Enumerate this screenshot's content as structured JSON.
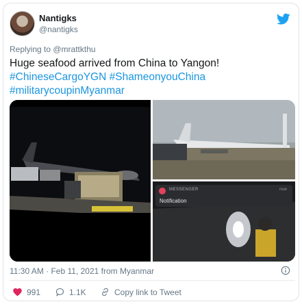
{
  "user": {
    "display_name": "Nantigks",
    "handle": "@nantigks"
  },
  "reply": {
    "prefix": "Replying to ",
    "to": "@mrattkthu"
  },
  "tweet": {
    "line1": "Huge seafood arrived from China to Yangon!",
    "hashtag1": "#ChineseCargoYGN",
    "hashtag2": "#ShameonyouChina",
    "hashtag3": "#militarycoupinMyanmar"
  },
  "media": {
    "notification": {
      "app": "MESSENGER",
      "time": "now",
      "title": "Notification"
    }
  },
  "meta": {
    "timestamp": "11:30 AM · Feb 11, 2021 from Myanmar"
  },
  "actions": {
    "likes": "991",
    "replies": "1.1K",
    "copy_link": "Copy link to Tweet"
  },
  "colors": {
    "brand": "#1da1f2",
    "like": "#e0245e",
    "hashtag": "#1b95e0",
    "muted": "#657786"
  },
  "icons": [
    "twitter-bird-icon",
    "info-icon",
    "heart-icon",
    "reply-bubble-icon",
    "link-icon"
  ]
}
